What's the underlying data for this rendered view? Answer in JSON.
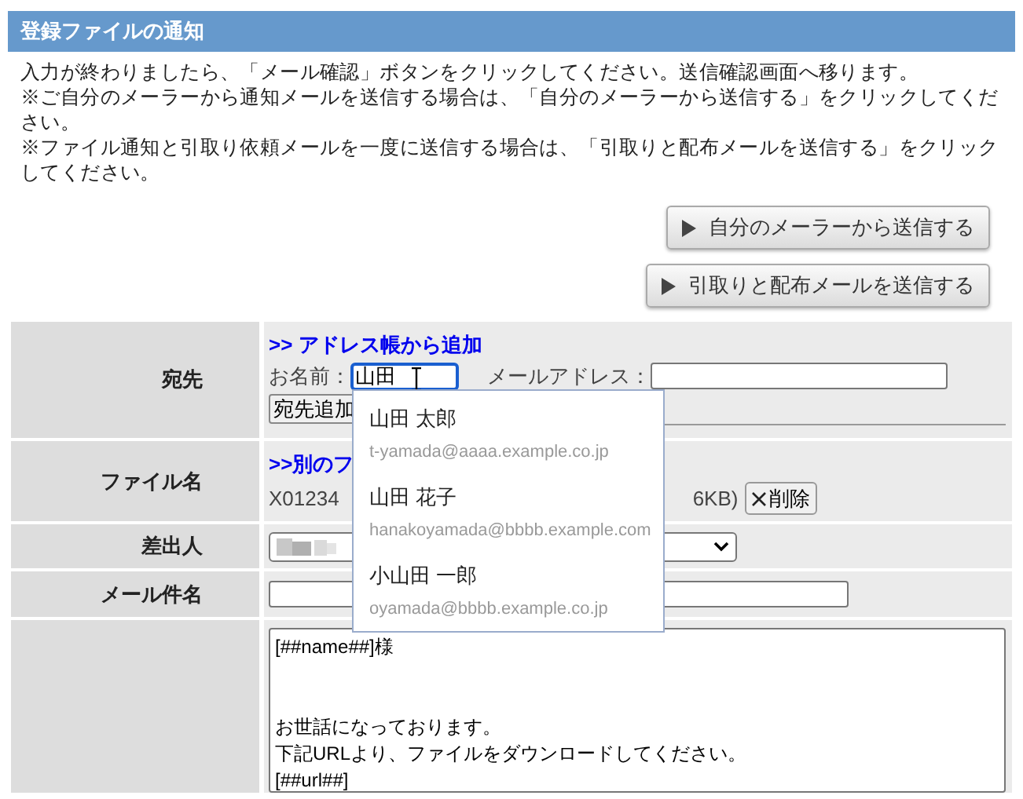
{
  "header": {
    "title": "登録ファイルの通知"
  },
  "instructions": [
    "入力が終わりましたら、「メール確認」ボタンをクリックしてください。送信確認画面へ移ります。",
    "※ご自分のメーラーから通知メールを送信する場合は、「自分のメーラーから送信する」をクリックしてください。",
    "※ファイル通知と引取り依頼メールを一度に送信する場合は、「引取りと配布メールを送信する」をクリックしてください。"
  ],
  "action_buttons": [
    {
      "label": "自分のメーラーから送信する"
    },
    {
      "label": "引取りと配布メールを送信する"
    }
  ],
  "form": {
    "recipient": {
      "label": "宛先",
      "link": ">> アドレス帳から追加",
      "name_label": "お名前：",
      "name_value": "山田",
      "email_label": "メールアドレス：",
      "add_button": "宛先追加"
    },
    "file": {
      "label": "ファイル名",
      "link": ">>別のフ",
      "file_name": "X01234",
      "file_size": "6KB)",
      "delete_button": "削除"
    },
    "sender": {
      "label": "差出人"
    },
    "subject": {
      "label": "メール件名"
    },
    "body": {
      "paragraphs": [
        [
          "[##name##]様"
        ],
        [
          "お世話になっております。",
          "下記URLより、ファイルをダウンロードしてください。",
          "[##url##]"
        ]
      ]
    }
  },
  "suggestions": [
    {
      "name": "山田 太郎",
      "email": "t-yamada@aaaa.example.co.jp"
    },
    {
      "name": "山田 花子",
      "email": "hanakoyamada@bbbb.example.com"
    },
    {
      "name": "小山田 一郎",
      "email": "oyamada@bbbb.example.co.jp"
    }
  ]
}
